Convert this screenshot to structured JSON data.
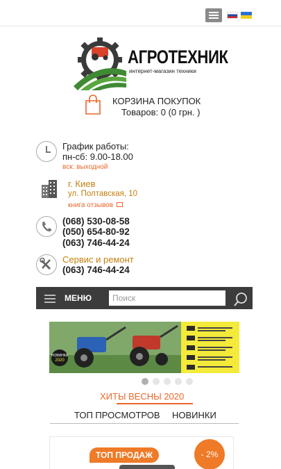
{
  "header": {
    "menu_icon": "hamburger-icon",
    "languages": [
      "ru",
      "ua"
    ]
  },
  "logo": {
    "title": "АГРОТЕХНИК",
    "subtitle": "интернет-магазин техники"
  },
  "cart": {
    "title": "КОРЗИНА ПОКУПОК",
    "count": "Товаров: 0 (0 грн. )",
    "icon": "shopping-bag-icon"
  },
  "schedule": {
    "title": "График работы:",
    "weekdays": "пн-сб: 9.00-18.00",
    "sunday": "вск: выходной",
    "icon": "clock-icon"
  },
  "address": {
    "city": "г. Киев",
    "street": "ул. Полтавская, 10",
    "reviews_link": "книга отзывов",
    "icon": "building-icon"
  },
  "phones": {
    "numbers": [
      "(068) 530-08-58",
      "(050) 654-80-92",
      "(063) 746-44-24"
    ],
    "icon": "phone-icon"
  },
  "service": {
    "title": "Сервис и ремонт",
    "phone": "(063) 746-44-24",
    "icon": "tools-icon"
  },
  "navbar": {
    "menu_label": "МЕНЮ",
    "search_placeholder": "Поиск"
  },
  "banner": {
    "badge": "НОВИНКИ 2020 РОКУ",
    "slides_total": 5,
    "active_slide": 1
  },
  "tabs": {
    "hits": "ХИТЫ ВЕСНЫ 2020",
    "top": "ТОП ПРОСМОТРОВ",
    "new": "НОВИНКИ"
  },
  "product": {
    "badge": "ТОП ПРОДАЖ",
    "discount": "- 2%"
  },
  "colors": {
    "accent": "#e8672a",
    "navbar": "#3c3c3c"
  }
}
